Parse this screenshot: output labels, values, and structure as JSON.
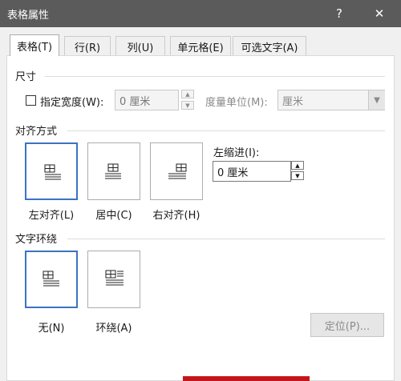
{
  "window": {
    "title": "表格属性",
    "help_btn": "?",
    "close_btn": "✕"
  },
  "tabs": [
    {
      "label": "表格(T)"
    },
    {
      "label": "行(R)"
    },
    {
      "label": "列(U)"
    },
    {
      "label": "单元格(E)"
    },
    {
      "label": "可选文字(A)"
    }
  ],
  "size": {
    "section": "尺寸",
    "specify_width_label": "指定宽度(W):",
    "width_value": "0 厘米",
    "unit_label": "度量单位(M):",
    "unit_value": "厘米"
  },
  "alignment": {
    "section": "对齐方式",
    "options": [
      {
        "label": "左对齐(L)"
      },
      {
        "label": "居中(C)"
      },
      {
        "label": "右对齐(H)"
      }
    ],
    "indent_label": "左缩进(I):",
    "indent_value": "0 厘米"
  },
  "wrapping": {
    "section": "文字环绕",
    "options": [
      {
        "label": "无(N)"
      },
      {
        "label": "环绕(A)"
      }
    ],
    "position_button": "定位(P)..."
  },
  "colors": {
    "titlebar": "#5b5b5b",
    "selected_border": "#3b73c1",
    "bottom_accent": "#c3161c"
  }
}
